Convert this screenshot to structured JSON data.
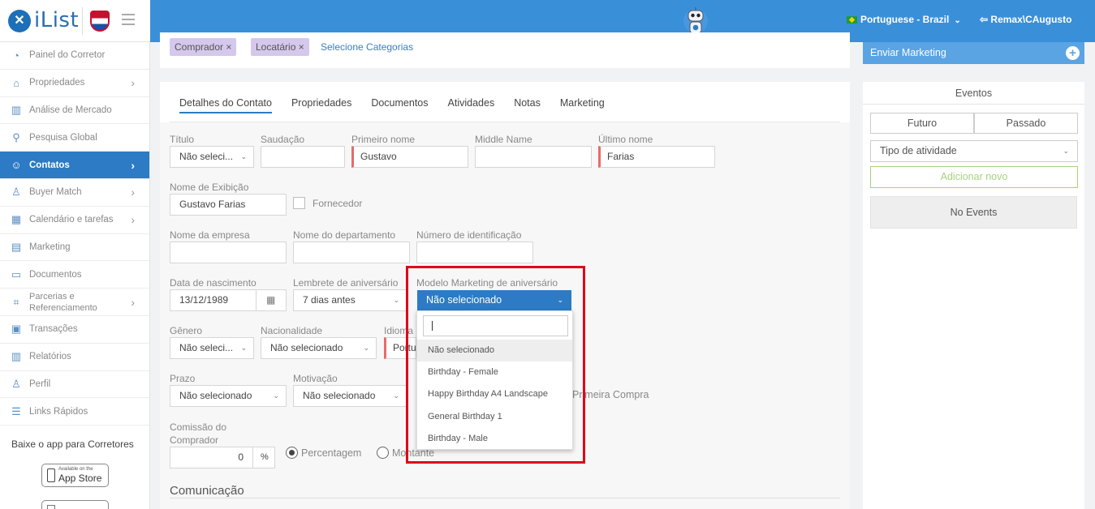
{
  "app": {
    "brand": "iList",
    "language": "Portuguese - Brazil",
    "user": "Remax\\CAugusto"
  },
  "sidebar": {
    "items": [
      {
        "label": "Painel do Corretor",
        "icon": "dashboard-icon",
        "arrow": false
      },
      {
        "label": "Propriedades",
        "icon": "home-icon",
        "arrow": true
      },
      {
        "label": "Análise de Mercado",
        "icon": "bar-chart-icon",
        "arrow": false
      },
      {
        "label": "Pesquisa Global",
        "icon": "search-icon",
        "arrow": false
      },
      {
        "label": "Contatos",
        "icon": "contacts-icon",
        "arrow": true,
        "active": true
      },
      {
        "label": "Buyer Match",
        "icon": "user-icon",
        "arrow": true
      },
      {
        "label": "Calendário e tarefas",
        "icon": "calendar-icon",
        "arrow": true
      },
      {
        "label": "Marketing",
        "icon": "newspaper-icon",
        "arrow": false
      },
      {
        "label": "Documentos",
        "icon": "folder-icon",
        "arrow": false
      },
      {
        "label": "Parcerias e Referenciamento",
        "icon": "tag-icon",
        "arrow": true
      },
      {
        "label": "Transações",
        "icon": "briefcase-icon",
        "arrow": false
      },
      {
        "label": "Relatórios",
        "icon": "bar-chart-icon",
        "arrow": false
      },
      {
        "label": "Perfil",
        "icon": "user-icon",
        "arrow": false
      },
      {
        "label": "Links Rápidos",
        "icon": "list-icon",
        "arrow": false
      }
    ],
    "app_promo": "Baixe o app para Corretores",
    "appstore_small": "Available on the",
    "appstore_big": "App Store"
  },
  "categories": {
    "chips": [
      "Comprador ×",
      "Locatário ×"
    ],
    "link": "Selecione Categorias"
  },
  "tabs": [
    "Detalhes do Contato",
    "Propriedades",
    "Documentos",
    "Atividades",
    "Notas",
    "Marketing"
  ],
  "form": {
    "titulo_label": "Título",
    "titulo_value": "Não seleci...",
    "saudacao_label": "Saudação",
    "primeiro_nome_label": "Primeiro nome",
    "primeiro_nome_value": "Gustavo",
    "middle_name_label": "Middle Name",
    "ultimo_nome_label": "Último nome",
    "ultimo_nome_value": "Farias",
    "exibicao_label": "Nome de Exibição",
    "exibicao_value": "Gustavo Farias",
    "fornecedor_label": "Fornecedor",
    "empresa_label": "Nome da empresa",
    "departamento_label": "Nome do departamento",
    "identificacao_label": "Número de identificação",
    "nascimento_label": "Data de nascimento",
    "nascimento_value": "13/12/1989",
    "lembrete_label": "Lembrete de aniversário",
    "lembrete_value": "7 dias antes",
    "modelo_label": "Modelo Marketing de aniversário",
    "modelo_value": "Não selecionado",
    "genero_label": "Gênero",
    "genero_value": "Não seleci...",
    "nacionalidade_label": "Nacionalidade",
    "nacionalidade_value": "Não selecionado",
    "idioma_label": "Idioma",
    "idioma_value": "Portu",
    "prazo_label": "Prazo",
    "prazo_value": "Não selecionado",
    "motivacao_label": "Motivação",
    "motivacao_value": "Não selecionado",
    "primeira_compra_label": "Primeira Compra",
    "comissao_label_1": "Comissão do",
    "comissao_label_2": "Comprador",
    "comissao_value": "0",
    "comissao_unit": "%",
    "percentagem_label": "Percentagem",
    "montante_label": "Montante",
    "comunicacao_title": "Comunicação"
  },
  "dropdown": {
    "search_value": "",
    "options": [
      "Não selecionado",
      "Birthday - Female",
      "Happy Birthday A4 Landscape",
      "General Birthday 1",
      "Birthday - Male"
    ],
    "highlighted_index": 0
  },
  "right_panel": {
    "marketing_button": "Enviar Marketing",
    "events_title": "Eventos",
    "tab_future": "Futuro",
    "tab_past": "Passado",
    "activity_select": "Tipo de atividade",
    "add_new": "Adicionar novo",
    "no_events": "No Events"
  },
  "colors": {
    "topbar": "#3a8fd9",
    "active_nav": "#2c7bc4",
    "highlight_frame": "#e0001a",
    "required_marker": "#e86b6b",
    "chip": "#d5c8ec"
  }
}
